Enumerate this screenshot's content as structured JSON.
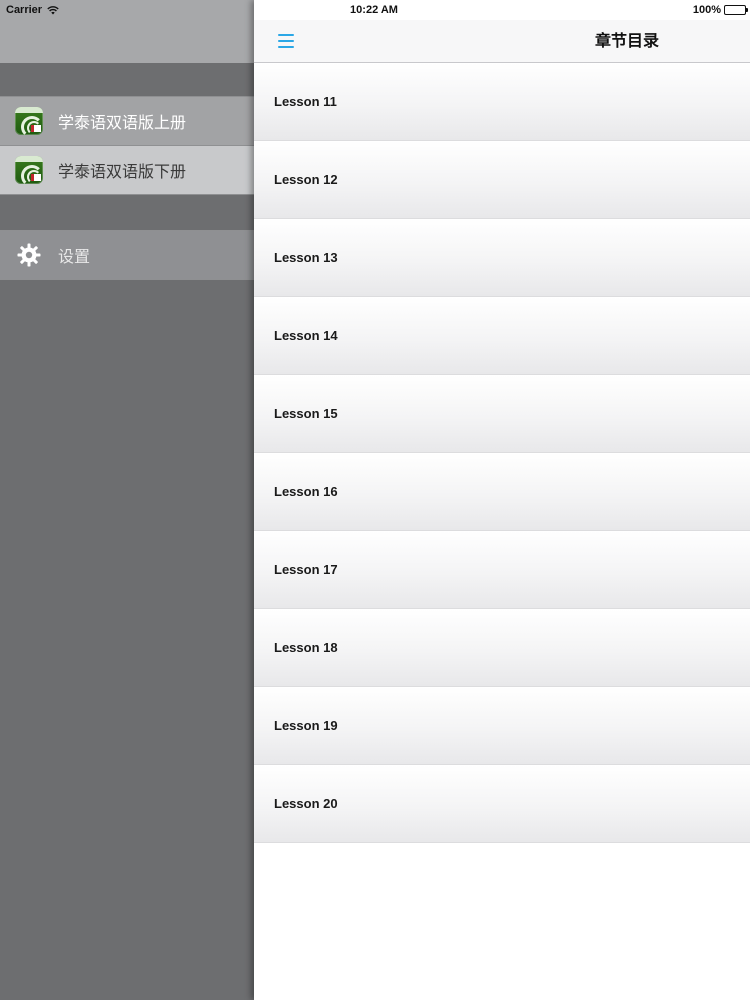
{
  "status_bar": {
    "carrier": "Carrier",
    "time": "10:22 AM",
    "battery": "100%"
  },
  "sidebar": {
    "books": [
      {
        "label": "学泰语双语版上册",
        "icon": "app-icon"
      },
      {
        "label": "学泰语双语版下册",
        "icon": "app-icon"
      }
    ],
    "settings": {
      "label": "设置",
      "icon": "gear-icon"
    }
  },
  "navbar": {
    "title": "章节目录",
    "menu_icon": "hamburger-icon",
    "accent_color": "#2ba7e6"
  },
  "lessons": [
    "Lesson 11",
    "Lesson 12",
    "Lesson 13",
    "Lesson 14",
    "Lesson 15",
    "Lesson 16",
    "Lesson 17",
    "Lesson 18",
    "Lesson 19",
    "Lesson 20"
  ]
}
